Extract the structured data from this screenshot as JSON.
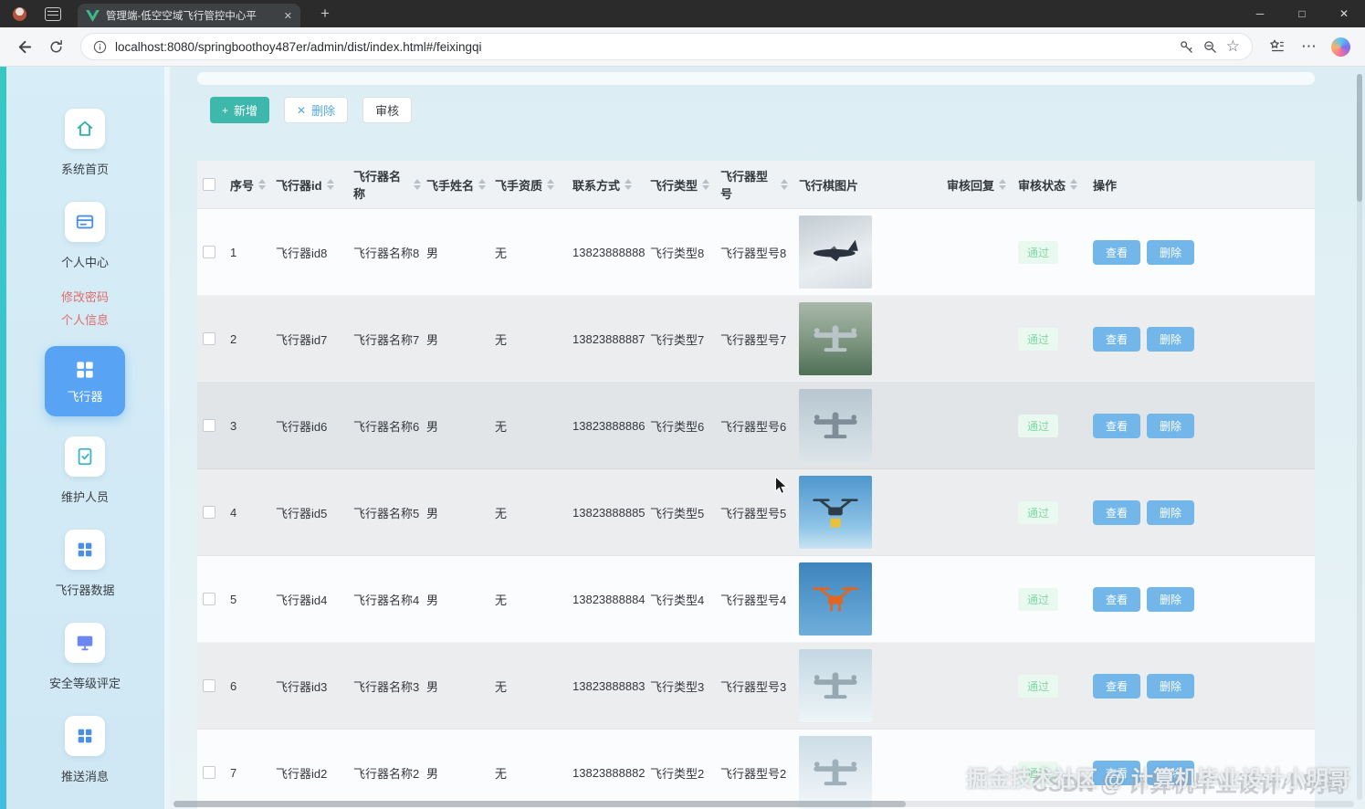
{
  "browser": {
    "tab_title": "管理端-低空空域飞行管控中心平",
    "url": "localhost:8080/springboothoy487er/admin/dist/index.html#/feixingqi"
  },
  "icons": {
    "minimize": "─",
    "maximize": "□",
    "close": "✕",
    "tab_close": "✕",
    "new_tab": "+",
    "star": "☆",
    "ellipsis": "⋯",
    "add_plus": "+",
    "delete_x": "✕"
  },
  "sidebar": {
    "items": [
      {
        "label": "系统首页"
      },
      {
        "label": "个人中心"
      },
      {
        "label": "修改密码"
      },
      {
        "label": "个人信息"
      },
      {
        "label": "飞行器",
        "active": true
      },
      {
        "label": "维护人员"
      },
      {
        "label": "飞行器数据"
      },
      {
        "label": "安全等级评定"
      },
      {
        "label": "推送消息"
      }
    ]
  },
  "toolbar": {
    "add": "新增",
    "delete": "删除",
    "review": "审核"
  },
  "colors": {
    "accent_teal": "#3eb8ab",
    "action_blue": "#73b7ea",
    "active_item_blue": "#58a3f3",
    "status_green": "#82d7a6",
    "link_red": "#e26b6b"
  },
  "table": {
    "headers": [
      {
        "label": "序号",
        "sortable": true
      },
      {
        "label": "飞行器id",
        "sortable": true
      },
      {
        "label": "飞行器名称",
        "sortable": true
      },
      {
        "label": "飞手姓名",
        "sortable": true
      },
      {
        "label": "飞手资质",
        "sortable": true
      },
      {
        "label": "联系方式",
        "sortable": true
      },
      {
        "label": "飞行类型",
        "sortable": true
      },
      {
        "label": "飞行器型号",
        "sortable": true
      },
      {
        "label": "飞行棋图片",
        "sortable": false
      },
      {
        "label": "审核回复",
        "sortable": true
      },
      {
        "label": "审核状态",
        "sortable": true
      },
      {
        "label": "操作",
        "sortable": false
      }
    ],
    "actions": {
      "view": "查看",
      "delete": "删除"
    },
    "rows": [
      {
        "no": "1",
        "aircraft_id": "飞行器id8",
        "name": "飞行器名称8",
        "pilot_name": "男",
        "pilot_qualification": "无",
        "contact": "13823888888",
        "flight_type": "飞行类型8",
        "model": "飞行器型号8",
        "review_reply": "",
        "review_status": "通过",
        "image": {
          "shape": "jet",
          "bg": "linear-gradient(160deg,#c2ccd2 0%,#e9eef1 60%,#d5dde2 100%)",
          "color": "#2b3340"
        }
      },
      {
        "no": "2",
        "aircraft_id": "飞行器id7",
        "name": "飞行器名称7",
        "pilot_name": "男",
        "pilot_qualification": "无",
        "contact": "13823888887",
        "flight_type": "飞行类型7",
        "model": "飞行器型号7",
        "review_reply": "",
        "review_status": "通过",
        "image": {
          "shape": "plane",
          "bg": "linear-gradient(180deg,#a9b8ab 0%,#7d957f 55%,#4e6f55 100%)",
          "color": "#b9c4c8"
        }
      },
      {
        "no": "3",
        "aircraft_id": "飞行器id6",
        "name": "飞行器名称6",
        "pilot_name": "男",
        "pilot_qualification": "无",
        "contact": "13823888886",
        "flight_type": "飞行类型6",
        "model": "飞行器型号6",
        "review_reply": "",
        "review_status": "通过",
        "image": {
          "shape": "plane",
          "bg": "linear-gradient(180deg,#b7c6d0 0%,#dbe5ea 100%)",
          "color": "#7e8d98"
        }
      },
      {
        "no": "4",
        "aircraft_id": "飞行器id5",
        "name": "飞行器名称5",
        "pilot_name": "男",
        "pilot_qualification": "无",
        "contact": "13823888885",
        "flight_type": "飞行类型5",
        "model": "飞行器型号5",
        "review_reply": "",
        "review_status": "通过",
        "image": {
          "shape": "dronebox",
          "bg": "linear-gradient(180deg,#4f97cd 0%,#8ec4e6 70%,#c9e4f2 100%)",
          "color": "#2e3d4a"
        }
      },
      {
        "no": "5",
        "aircraft_id": "飞行器id4",
        "name": "飞行器名称4",
        "pilot_name": "男",
        "pilot_qualification": "无",
        "contact": "13823888884",
        "flight_type": "飞行类型4",
        "model": "飞行器型号4",
        "review_reply": "",
        "review_status": "通过",
        "image": {
          "shape": "drone",
          "bg": "linear-gradient(180deg,#3d85bd 0%,#6faedb 100%)",
          "color": "#e2661f"
        }
      },
      {
        "no": "6",
        "aircraft_id": "飞行器id3",
        "name": "飞行器名称3",
        "pilot_name": "男",
        "pilot_qualification": "无",
        "contact": "13823888883",
        "flight_type": "飞行类型3",
        "model": "飞行器型号3",
        "review_reply": "",
        "review_status": "通过",
        "image": {
          "shape": "plane",
          "bg": "linear-gradient(180deg,#c3d8e3 0%,#edf5f8 100%)",
          "color": "#98a8b2"
        }
      },
      {
        "no": "7",
        "aircraft_id": "飞行器id2",
        "name": "飞行器名称2",
        "pilot_name": "男",
        "pilot_qualification": "无",
        "contact": "13823888882",
        "flight_type": "飞行类型2",
        "model": "飞行器型号2",
        "review_reply": "",
        "review_status": "通过",
        "image": {
          "shape": "plane",
          "bg": "linear-gradient(180deg,#cddde7 0%,#f2f7fa 100%)",
          "color": "#9fb0ba"
        }
      }
    ]
  },
  "watermark": {
    "line1": "掘金技术社区 @ 计算机毕业设计小明哥",
    "line2": "CSDN @ 计算机毕业设计小明哥"
  }
}
